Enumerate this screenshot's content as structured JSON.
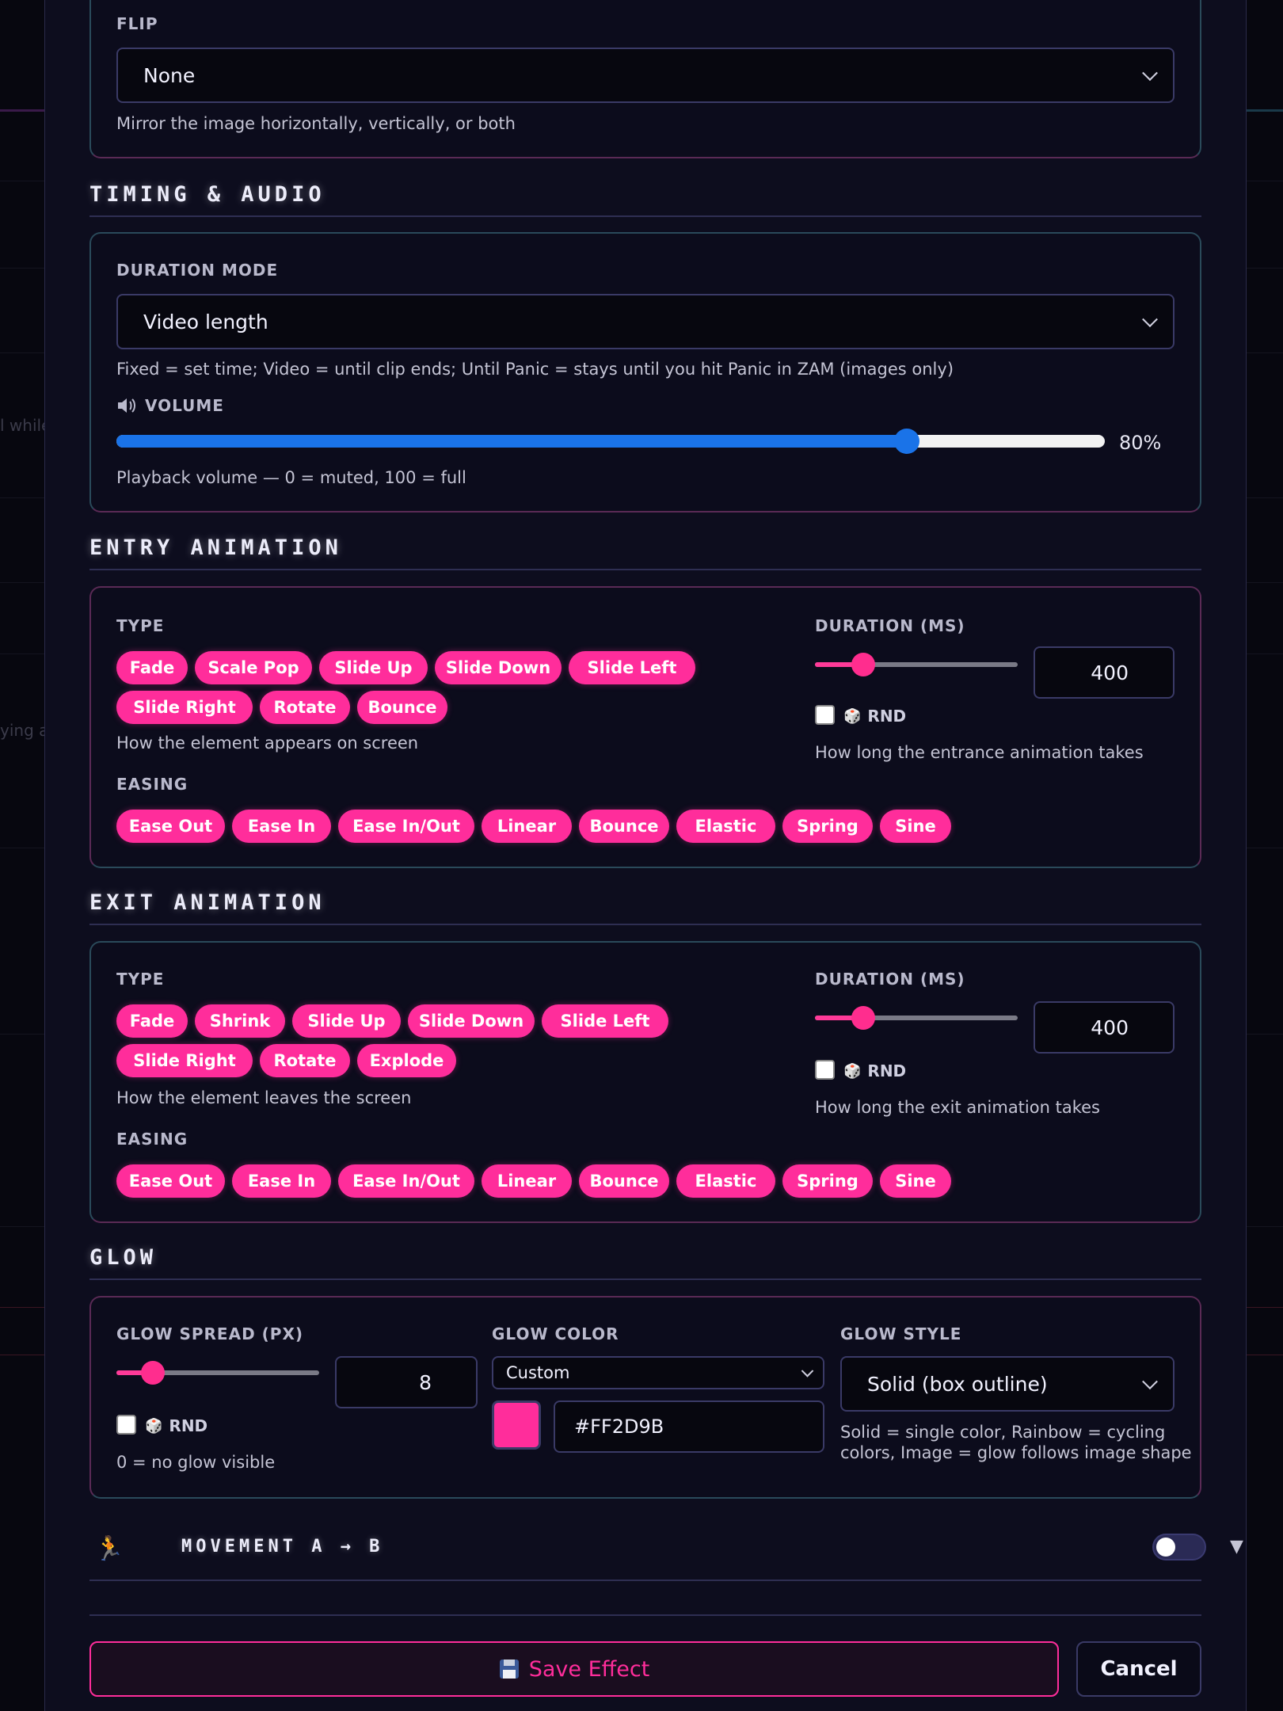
{
  "background": {
    "fragments": [
      "l while s",
      "ying a c"
    ]
  },
  "flip": {
    "label": "FLIP",
    "value": "None",
    "help": "Mirror the image horizontally, vertically, or both"
  },
  "timing": {
    "title": "TIMING & AUDIO",
    "duration_mode_label": "DURATION MODE",
    "duration_mode_value": "Video length",
    "duration_mode_help": "Fixed = set time; Video = until clip ends; Until Panic = stays until you hit Panic in ZAM (images only)",
    "volume_icon": "speaker-icon",
    "volume_label": "VOLUME",
    "volume_value": 80,
    "volume_text": "80%",
    "volume_help": "Playback volume — 0 = muted, 100 = full"
  },
  "entry": {
    "title": "ENTRY ANIMATION",
    "type_label": "TYPE",
    "types": [
      "Fade",
      "Scale Pop",
      "Slide Up",
      "Slide Down",
      "Slide Left",
      "Slide Right",
      "Rotate",
      "Bounce"
    ],
    "type_help": "How the element appears on screen",
    "easing_label": "EASING",
    "easings": [
      "Ease Out",
      "Ease In",
      "Ease In/Out",
      "Linear",
      "Bounce",
      "Elastic",
      "Spring",
      "Sine"
    ],
    "duration_label": "DURATION (MS)",
    "duration_value": "400",
    "rnd_label": "RND",
    "duration_help": "How long the entrance animation takes"
  },
  "exit": {
    "title": "EXIT ANIMATION",
    "type_label": "TYPE",
    "types": [
      "Fade",
      "Shrink",
      "Slide Up",
      "Slide Down",
      "Slide Left",
      "Slide Right",
      "Rotate",
      "Explode"
    ],
    "type_help": "How the element leaves the screen",
    "easing_label": "EASING",
    "easings": [
      "Ease Out",
      "Ease In",
      "Ease In/Out",
      "Linear",
      "Bounce",
      "Elastic",
      "Spring",
      "Sine"
    ],
    "duration_label": "DURATION (MS)",
    "duration_value": "400",
    "rnd_label": "RND",
    "duration_help": "How long the exit animation takes"
  },
  "glow": {
    "title": "GLOW",
    "spread_label": "GLOW SPREAD (PX)",
    "spread_value": "8",
    "rnd_label": "RND",
    "spread_help": "0 = no glow visible",
    "color_label": "GLOW COLOR",
    "color_mode": "Custom",
    "color_hex": "#FF2D9B",
    "style_label": "GLOW STYLE",
    "style_value": "Solid (box outline)",
    "style_help_1": "Solid = single color, Rainbow = cycling",
    "style_help_2": "colors, Image = glow follows image shape"
  },
  "movement": {
    "icon": "running-person-icon",
    "title": "MOVEMENT A → B",
    "enabled": false
  },
  "actions": {
    "save_icon": "floppy-disk-icon",
    "save_label": "Save Effect",
    "cancel_label": "Cancel"
  },
  "colors": {
    "accent": "#ff2d9b",
    "slider_blue": "#1a73e8"
  }
}
